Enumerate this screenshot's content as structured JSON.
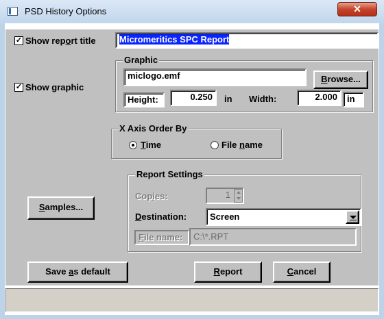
{
  "window": {
    "title": "PSD History Options",
    "close_glyph": "✕"
  },
  "report_title": {
    "label_pre": "Show rep",
    "label_key": "o",
    "label_post": "rt title",
    "checked": true,
    "value": "Micromeritics SPC Report"
  },
  "graphic": {
    "show_label": "Show graphic",
    "checked": true,
    "group_title": "Graphic",
    "file_value": "miclogo.emf",
    "browse_key": "B",
    "browse_rest": "rowse...",
    "height_label": "Height:",
    "height_value": "0.250",
    "height_unit": "in",
    "width_label": "Width:",
    "width_value": "2.000",
    "width_unit": "in"
  },
  "x_axis": {
    "group_title": "X Axis Order By",
    "time_key": "T",
    "time_rest": "ime",
    "time_selected": true,
    "filename_pre": "File ",
    "filename_key": "n",
    "filename_post": "ame",
    "filename_selected": false
  },
  "report_settings": {
    "group_title": "Report Settings",
    "copies_pre": "Cop",
    "copies_key": "i",
    "copies_post": "es:",
    "copies_value": "1",
    "destination_key": "D",
    "destination_rest": "estination:",
    "destination_value": "Screen",
    "filename_key": "F",
    "filename_rest": "ile name:",
    "filename_value": "C:\\*.RPT"
  },
  "buttons": {
    "samples_key": "S",
    "samples_rest": "amples...",
    "save_pre": "Save ",
    "save_key": "a",
    "save_post": "s default",
    "report_key": "R",
    "report_rest": "eport",
    "cancel_key": "C",
    "cancel_rest": "ancel"
  },
  "colors": {
    "title_bar": "#c8dcf0",
    "dialog_face": "#c0c0c0",
    "selection": "#0a24ff",
    "close_red": "#c5442b"
  }
}
